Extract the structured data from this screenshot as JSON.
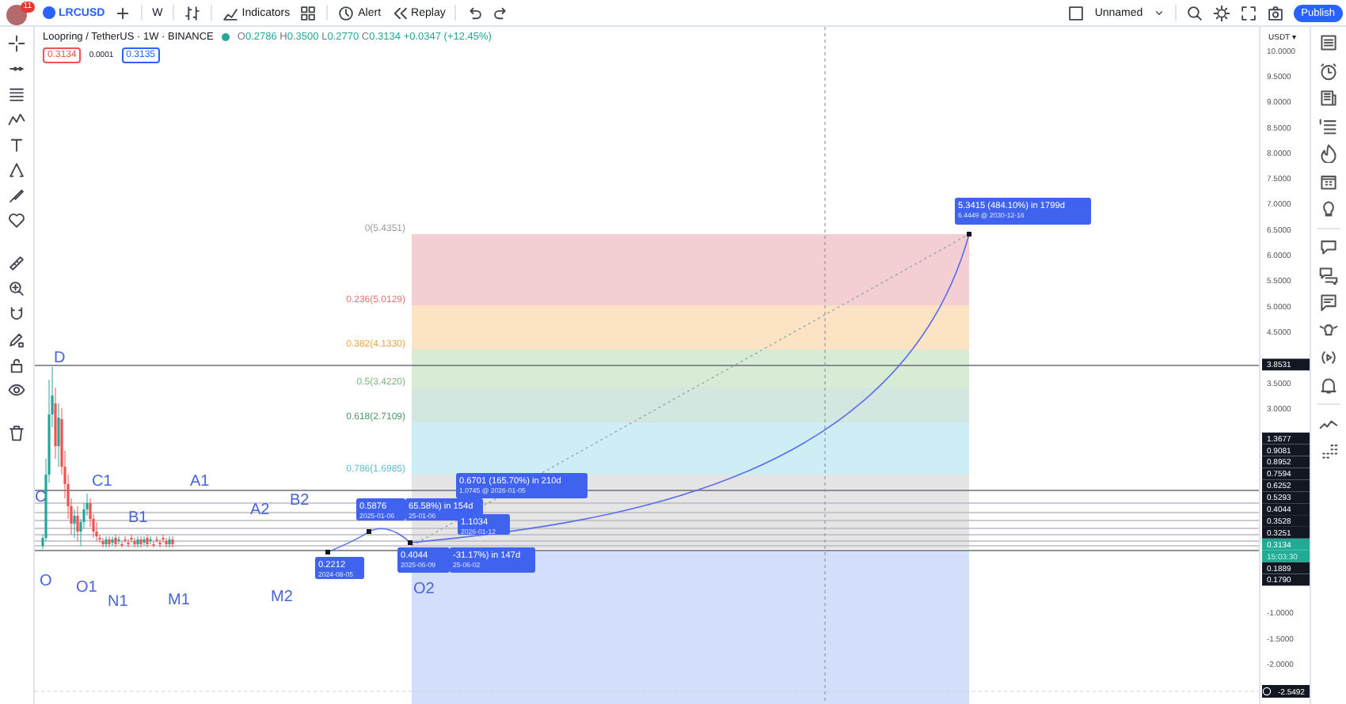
{
  "toolbar": {
    "avatar_badge": "11",
    "symbol": "LRCUSD",
    "interval": "W",
    "buttons": [
      {
        "kind": "indicators",
        "label": "Indicators"
      },
      {
        "kind": "alert",
        "label": "Alert"
      },
      {
        "kind": "replay",
        "label": "Replay"
      }
    ],
    "layout_name": "Unnamed",
    "publish": "Publish"
  },
  "legend": {
    "title": "Loopring / TetherUS · 1W · BINANCE",
    "ohlc": [
      {
        "key": "O",
        "value": "0.2786"
      },
      {
        "key": "H",
        "value": "0.3500"
      },
      {
        "key": "L",
        "value": "0.2770"
      },
      {
        "key": "C",
        "value": "0.3134"
      }
    ],
    "change": "+0.0347 (+12.45%)",
    "sell": "0.3134",
    "spread": "0.0001",
    "buy": "0.3135"
  },
  "price_axis": {
    "currency": "USDT ▾",
    "ticks": [
      "10.0000",
      "9.5000",
      "9.0000",
      "8.5000",
      "8.0000",
      "7.5000",
      "7.0000",
      "6.5000",
      "6.0000",
      "5.5000",
      "5.0000",
      "4.5000",
      "3.5000",
      "3.0000",
      "-1.0000",
      "-1.5000",
      "-2.0000"
    ],
    "markers": [
      {
        "value": "3.8531",
        "kind": "line"
      },
      {
        "value": "1.3677",
        "kind": "stack"
      },
      {
        "value": "0.9081",
        "kind": "stack"
      },
      {
        "value": "0.8952",
        "kind": "stack"
      },
      {
        "value": "0.7594",
        "kind": "stack"
      },
      {
        "value": "0.6252",
        "kind": "stack"
      },
      {
        "value": "0.5293",
        "kind": "stack"
      },
      {
        "value": "0.4044",
        "kind": "stack"
      },
      {
        "value": "0.3528",
        "kind": "stack"
      },
      {
        "value": "0.3251",
        "kind": "stack"
      },
      {
        "value": "0.3134",
        "kind": "last"
      },
      {
        "value": "15:03:30",
        "kind": "countdown"
      },
      {
        "value": "0.1889",
        "kind": "stack"
      },
      {
        "value": "0.1790",
        "kind": "stack"
      }
    ],
    "cursor_price": "-2.5492"
  },
  "fib_levels": [
    {
      "label": "0(5.4351)",
      "color": "#9e9e9e"
    },
    {
      "label": "0.236(5.0129)",
      "color": "#e57373"
    },
    {
      "label": "0.382(4.1330)",
      "color": "#f0a64a"
    },
    {
      "label": "0.5(3.4220)",
      "color": "#7cb87f"
    },
    {
      "label": "0.618(2.7109)",
      "color": "#4c9a6a"
    },
    {
      "label": "0.786(1.6985)",
      "color": "#5cbfd6"
    }
  ],
  "wave_labels": [
    "D",
    "C",
    "C1",
    "A1",
    "B1",
    "A2",
    "B2",
    "O",
    "O1",
    "N1",
    "M1",
    "M2",
    "O2"
  ],
  "tooltips": [
    {
      "lines": [
        "5.3415 (484.10%) in 1799d",
        "6.4449 @ 2030-12-16"
      ]
    },
    {
      "lines": [
        "0.6701 (165.70%) in 210d",
        "1.0745 @ 2026-01-05"
      ]
    },
    {
      "lines": [
        "0.5876",
        "2025-01-06"
      ]
    },
    {
      "lines": [
        "65.58%) in 154d",
        "25-01-06"
      ]
    },
    {
      "lines": [
        "1.1034",
        "2026-01-12"
      ]
    },
    {
      "lines": [
        "0.2212",
        "2024-08-05"
      ]
    },
    {
      "lines": [
        "0.4044",
        "2025-06-09"
      ]
    },
    {
      "lines": [
        "-31.17%) in 147d",
        "25-06-02"
      ]
    }
  ]
}
